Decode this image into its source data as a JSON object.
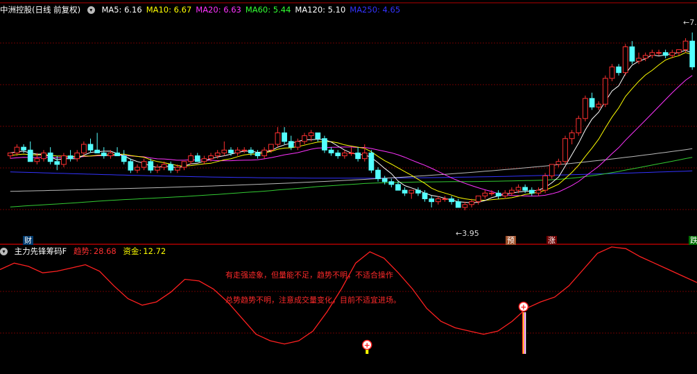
{
  "colors": {
    "bg": "#000000",
    "grid": "#6e0000",
    "candle_up": "#ff3030",
    "candle_down": "#54ffff",
    "ma5": "#ffffff",
    "ma10": "#ffff00",
    "ma20": "#ff33ff",
    "ma60": "#33cc33",
    "ma120": "#bbbbbb",
    "ma250": "#3333ff",
    "indicator_line": "#ff2020"
  },
  "main_panel": {
    "title": "中洲控股(日线 前复权)",
    "legend": [
      {
        "key": "ma5",
        "label": "MA5:",
        "value": "6.16",
        "color": "#ffffff"
      },
      {
        "key": "ma10",
        "label": "MA10:",
        "value": "6.67",
        "color": "#ffff00"
      },
      {
        "key": "ma20",
        "label": "MA20:",
        "value": "6.63",
        "color": "#ff33ff"
      },
      {
        "key": "ma60",
        "label": "MA60:",
        "value": "5.44",
        "color": "#33ff33"
      },
      {
        "key": "ma120",
        "label": "MA120:",
        "value": "5.10",
        "color": "#ffffff"
      },
      {
        "key": "ma250",
        "label": "MA250:",
        "value": "4.65",
        "color": "#3333ff"
      }
    ],
    "low_marker": "3.95",
    "high_marker": "7."
  },
  "markers": {
    "cai": "财",
    "yu": "预",
    "zhang": "涨",
    "die": "跌"
  },
  "indicator_panel": {
    "title": "主力先锋筹码F",
    "trend_label": "趋势:",
    "trend_value": "28.68",
    "fund_label": "资金:",
    "fund_value": "12.72",
    "note1": "有走强迹象，但量能不足，趋势不明，不适合操作",
    "note2": "总势趋势不明，注意成交量变化，目前不适宜进场。"
  },
  "chart_data": [
    {
      "type": "candlestick",
      "title": "中洲控股(日线 前复权)",
      "y_range_visible": [
        3.95,
        7.0
      ],
      "candles": [
        [
          4.9,
          4.95,
          4.85,
          4.95
        ],
        [
          4.95,
          5.1,
          4.9,
          5.05
        ],
        [
          5.05,
          5.1,
          4.95,
          5.0
        ],
        [
          5.0,
          5.15,
          4.95,
          4.8
        ],
        [
          4.8,
          4.95,
          4.75,
          4.85
        ],
        [
          4.85,
          5.0,
          4.8,
          4.95
        ],
        [
          4.95,
          5.05,
          4.75,
          4.8
        ],
        [
          4.8,
          4.9,
          4.65,
          4.75
        ],
        [
          4.75,
          4.95,
          4.7,
          4.9
        ],
        [
          4.9,
          5.0,
          4.8,
          4.85
        ],
        [
          4.85,
          5.0,
          4.8,
          4.95
        ],
        [
          4.95,
          5.15,
          4.9,
          5.1
        ],
        [
          5.1,
          5.2,
          4.95,
          5.0
        ],
        [
          5.0,
          5.3,
          4.95,
          4.95
        ],
        [
          4.95,
          5.05,
          4.85,
          4.9
        ],
        [
          4.9,
          5.0,
          4.85,
          4.95
        ],
        [
          4.95,
          5.05,
          4.9,
          4.9
        ],
        [
          4.9,
          5.0,
          4.75,
          4.8
        ],
        [
          4.8,
          4.85,
          4.6,
          4.65
        ],
        [
          4.65,
          4.75,
          4.6,
          4.7
        ],
        [
          4.7,
          4.85,
          4.65,
          4.8
        ],
        [
          4.8,
          4.85,
          4.6,
          4.65
        ],
        [
          4.65,
          4.75,
          4.6,
          4.7
        ],
        [
          4.7,
          4.8,
          4.65,
          4.75
        ],
        [
          4.75,
          4.8,
          4.6,
          4.65
        ],
        [
          4.65,
          4.75,
          4.6,
          4.7
        ],
        [
          4.7,
          4.8,
          4.65,
          4.8
        ],
        [
          4.8,
          4.95,
          4.75,
          4.9
        ],
        [
          4.9,
          4.95,
          4.8,
          4.8
        ],
        [
          4.8,
          4.9,
          4.75,
          4.85
        ],
        [
          4.85,
          4.95,
          4.8,
          4.9
        ],
        [
          4.9,
          5.0,
          4.85,
          4.95
        ],
        [
          4.95,
          5.15,
          4.9,
          5.0
        ],
        [
          5.0,
          5.05,
          4.9,
          4.95
        ],
        [
          4.95,
          5.05,
          4.9,
          5.0
        ],
        [
          5.0,
          5.05,
          4.95,
          5.0
        ],
        [
          5.0,
          5.05,
          4.9,
          4.95
        ],
        [
          4.95,
          5.0,
          4.85,
          4.9
        ],
        [
          4.9,
          5.05,
          4.85,
          5.0
        ],
        [
          5.0,
          5.1,
          4.95,
          5.1
        ],
        [
          5.1,
          5.4,
          5.05,
          5.3
        ],
        [
          5.3,
          5.4,
          5.1,
          5.15
        ],
        [
          5.15,
          5.25,
          5.0,
          5.05
        ],
        [
          5.05,
          5.2,
          5.0,
          5.15
        ],
        [
          5.15,
          5.3,
          5.1,
          5.25
        ],
        [
          5.25,
          5.35,
          5.15,
          5.3
        ],
        [
          5.3,
          5.3,
          5.15,
          5.2
        ],
        [
          5.2,
          5.25,
          4.95,
          5.0
        ],
        [
          5.0,
          5.05,
          4.9,
          4.95
        ],
        [
          4.95,
          5.0,
          4.85,
          4.9
        ],
        [
          4.9,
          5.0,
          4.85,
          4.95
        ],
        [
          4.95,
          5.05,
          4.9,
          4.95
        ],
        [
          4.95,
          5.05,
          4.8,
          4.85
        ],
        [
          4.85,
          5.1,
          4.8,
          4.95
        ],
        [
          4.95,
          5.0,
          4.6,
          4.65
        ],
        [
          4.65,
          4.7,
          4.45,
          4.5
        ],
        [
          4.5,
          4.55,
          4.4,
          4.45
        ],
        [
          4.45,
          4.5,
          4.35,
          4.4
        ],
        [
          4.4,
          4.45,
          4.3,
          4.3
        ],
        [
          4.3,
          4.35,
          4.2,
          4.25
        ],
        [
          4.25,
          4.3,
          4.15,
          4.3
        ],
        [
          4.3,
          4.35,
          4.2,
          4.25
        ],
        [
          4.25,
          4.3,
          4.1,
          4.15
        ],
        [
          4.15,
          4.2,
          4.0,
          4.1
        ],
        [
          4.1,
          4.2,
          4.05,
          4.15
        ],
        [
          4.15,
          4.2,
          4.1,
          4.15
        ],
        [
          4.15,
          4.2,
          4.05,
          4.1
        ],
        [
          4.1,
          4.15,
          4.0,
          4.0
        ],
        [
          4.0,
          4.1,
          3.95,
          4.05
        ],
        [
          4.05,
          4.15,
          4.0,
          4.1
        ],
        [
          4.1,
          4.2,
          4.05,
          4.2
        ],
        [
          4.2,
          4.3,
          4.15,
          4.25
        ],
        [
          4.25,
          4.3,
          4.2,
          4.25
        ],
        [
          4.25,
          4.3,
          4.15,
          4.2
        ],
        [
          4.2,
          4.3,
          4.15,
          4.25
        ],
        [
          4.25,
          4.35,
          4.2,
          4.3
        ],
        [
          4.3,
          4.4,
          4.25,
          4.35
        ],
        [
          4.35,
          4.4,
          4.25,
          4.3
        ],
        [
          4.3,
          4.35,
          4.2,
          4.25
        ],
        [
          4.25,
          4.35,
          4.2,
          4.3
        ],
        [
          4.3,
          4.6,
          4.25,
          4.55
        ],
        [
          4.55,
          4.75,
          4.5,
          4.75
        ],
        [
          4.75,
          4.85,
          4.7,
          4.8
        ],
        [
          4.8,
          5.25,
          4.75,
          5.2
        ],
        [
          5.2,
          5.35,
          5.1,
          5.3
        ],
        [
          5.3,
          5.6,
          5.25,
          5.55
        ],
        [
          5.55,
          5.95,
          5.5,
          5.9
        ],
        [
          5.9,
          6.0,
          5.7,
          5.75
        ],
        [
          5.75,
          5.85,
          5.7,
          5.8
        ],
        [
          5.8,
          6.3,
          5.75,
          6.25
        ],
        [
          6.25,
          6.5,
          6.2,
          6.45
        ],
        [
          6.45,
          6.5,
          6.3,
          6.35
        ],
        [
          6.35,
          6.85,
          6.3,
          6.8
        ],
        [
          6.8,
          6.9,
          6.5,
          6.55
        ],
        [
          6.55,
          6.7,
          6.5,
          6.6
        ],
        [
          6.6,
          6.7,
          6.55,
          6.65
        ],
        [
          6.65,
          6.75,
          6.6,
          6.7
        ],
        [
          6.7,
          6.75,
          6.65,
          6.7
        ],
        [
          6.7,
          6.75,
          6.6,
          6.65
        ],
        [
          6.65,
          6.75,
          6.6,
          6.7
        ],
        [
          6.7,
          6.75,
          6.65,
          6.75
        ],
        [
          6.75,
          6.95,
          6.7,
          6.9
        ],
        [
          6.9,
          7.05,
          6.4,
          6.45
        ]
      ]
    },
    {
      "type": "line",
      "title": "主力先锋筹码F",
      "series": [
        {
          "name": "趋势",
          "values": [
            62,
            66,
            64,
            60,
            61,
            63,
            65,
            61,
            52,
            44,
            40,
            42,
            48,
            56,
            55,
            50,
            42,
            32,
            22,
            18,
            16,
            18,
            24,
            36,
            50,
            66,
            73,
            69,
            60,
            50,
            38,
            30,
            26,
            24,
            22,
            24,
            30,
            38,
            42,
            45,
            52,
            62,
            72,
            76,
            75,
            70,
            66,
            62,
            58,
            54
          ]
        }
      ],
      "signals": [
        {
          "index": 26,
          "label": "+"
        },
        {
          "index": 37,
          "label": "+"
        }
      ]
    }
  ]
}
